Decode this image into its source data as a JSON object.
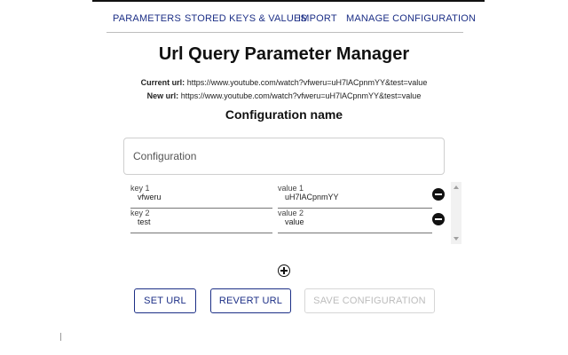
{
  "nav": {
    "tabs": [
      "PARAMETERS",
      "STORED KEYS & VALUES",
      "IMPORT",
      "MANAGE CONFIGURATION"
    ]
  },
  "title": "Url Query Parameter Manager",
  "current_url": {
    "label": "Current url:",
    "value": "https://www.youtube.com/watch?vfweru=uH7lACpnmYY&test=value"
  },
  "new_url": {
    "label": "New url:",
    "value": "https://www.youtube.com/watch?vfweru=uH7lACpnmYY&test=value"
  },
  "config_section_title": "Configuration name",
  "config_input": {
    "placeholder": "Configuration",
    "value": ""
  },
  "params": [
    {
      "key_label": "key 1",
      "key": "vfweru",
      "value_label": "value 1",
      "value": "uH7lACpnmYY"
    },
    {
      "key_label": "key 2",
      "key": "test",
      "value_label": "value 2",
      "value": "value"
    }
  ],
  "buttons": {
    "set_url": "SET URL",
    "revert_url": "REVERT URL",
    "save_configuration": "SAVE CONFIGURATION"
  },
  "colors": {
    "accent": "#1c2f86",
    "disabled": "#bcbcbc"
  }
}
